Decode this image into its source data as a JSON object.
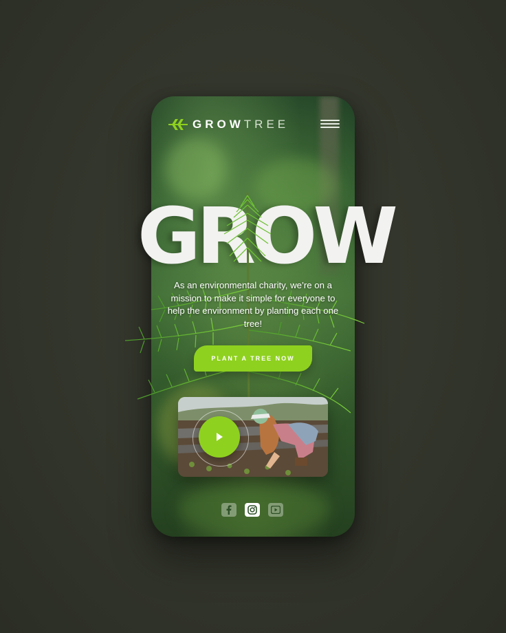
{
  "brand": {
    "part1": "GROW",
    "part2": "TREE"
  },
  "hero": {
    "word": "GROW"
  },
  "mission": {
    "text": "As an environmental charity, we’re on a mission to make it simple for everyone to help the environment by planting each one tree!"
  },
  "cta": {
    "label": "PLANT A TREE NOW"
  },
  "colors": {
    "accent": "#8fd11f",
    "background": "#32352b",
    "phone_dark": "#1f3f25"
  },
  "icons": {
    "logo": "leaf-branch-icon",
    "menu": "hamburger-menu-icon",
    "play": "play-icon",
    "social": [
      "facebook-icon",
      "instagram-icon",
      "youtube-icon"
    ]
  }
}
